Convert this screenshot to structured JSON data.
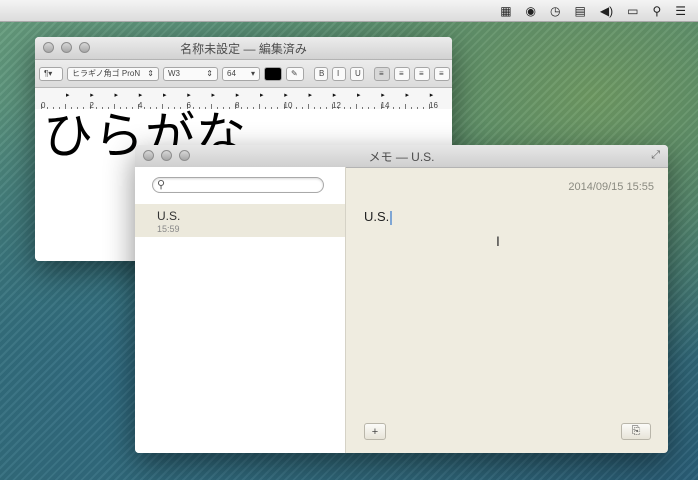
{
  "menubar": {
    "icons": [
      "qr-code-icon",
      "record-icon",
      "time-machine-icon",
      "flag-icon",
      "volume-icon",
      "battery-icon",
      "search-icon",
      "list-icon"
    ]
  },
  "textedit": {
    "title": "名称未設定 — 編集済み",
    "toolbar": {
      "paragraph_label": "¶▾",
      "font_name": "ヒラギノ角ゴ ProN",
      "font_weight": "W3",
      "font_size": "64",
      "bold": "B",
      "italic": "I",
      "underline": "U"
    },
    "ruler_numbers": [
      "0",
      "2",
      "4",
      "6",
      "8",
      "10",
      "12",
      "14",
      "16"
    ],
    "document_text": "ひらがな"
  },
  "notes": {
    "title": "メモ — U.S.",
    "search_placeholder": "",
    "items": [
      {
        "title": "U.S.",
        "time": "15:59"
      }
    ],
    "content": {
      "date": "2014/09/15 15:55",
      "text": "U.S."
    },
    "add_label": "+",
    "share_label": "⎘"
  }
}
